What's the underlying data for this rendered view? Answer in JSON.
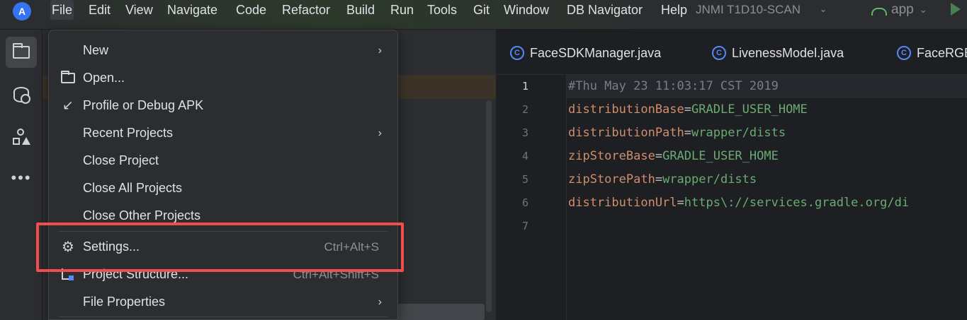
{
  "menubar": {
    "logo": "A",
    "items": [
      "File",
      "Edit",
      "View",
      "Navigate",
      "Code",
      "Refactor",
      "Build",
      "Run",
      "Tools",
      "Git",
      "Window",
      "DB Navigator",
      "Help"
    ],
    "project_name": "JNMI T1D10-SCAN",
    "run_config": "app"
  },
  "tabs": [
    "FaceSDKManager.java",
    "LivenessModel.java",
    "FaceRGB"
  ],
  "tab_icon_letter": "C",
  "editor": {
    "line_numbers": [
      "1",
      "2",
      "3",
      "4",
      "5",
      "6",
      "7"
    ],
    "lines": [
      {
        "comment": "#Thu May 23 11:03:17 CST 2019"
      },
      {
        "key": "distributionBase",
        "eq": "=",
        "val": "GRADLE_USER_HOME"
      },
      {
        "key": "distributionPath",
        "eq": "=",
        "val": "wrapper/dists"
      },
      {
        "key": "zipStoreBase",
        "eq": "=",
        "val": "GRADLE_USER_HOME"
      },
      {
        "key": "zipStorePath",
        "eq": "=",
        "val": "wrapper/dists"
      },
      {
        "key": "distributionUrl",
        "eq": "=",
        "val": "https\\://services.gradle.org/di"
      }
    ]
  },
  "file_menu": {
    "items": [
      {
        "label": "New",
        "shortcut": "",
        "submenu": true,
        "icon": ""
      },
      {
        "label": "Open...",
        "shortcut": "",
        "submenu": false,
        "icon": "open-folder-icon"
      },
      {
        "label": "Profile or Debug APK",
        "shortcut": "",
        "submenu": false,
        "icon": "profile-debug-icon"
      },
      {
        "label": "Recent Projects",
        "shortcut": "",
        "submenu": true,
        "icon": ""
      },
      {
        "label": "Close Project",
        "shortcut": "",
        "submenu": false,
        "icon": ""
      },
      {
        "label": "Close All Projects",
        "shortcut": "",
        "submenu": false,
        "icon": ""
      },
      {
        "label": "Close Other Projects",
        "shortcut": "",
        "submenu": false,
        "icon": ""
      },
      {
        "label": "Settings...",
        "shortcut": "Ctrl+Alt+S",
        "submenu": false,
        "icon": "gear-icon"
      },
      {
        "label": "Project Structure...",
        "shortcut": "Ctrl+Alt+Shift+S",
        "submenu": false,
        "icon": "project-structure-icon"
      },
      {
        "label": "File Properties",
        "shortcut": "",
        "submenu": true,
        "icon": ""
      }
    ],
    "highlighted_item": "Settings...",
    "highlight_color": "#f04d4d"
  },
  "colors": {
    "comment": "#7a7e85",
    "key": "#cf8e6d",
    "value": "#6aab73",
    "accent": "#3574f0"
  }
}
